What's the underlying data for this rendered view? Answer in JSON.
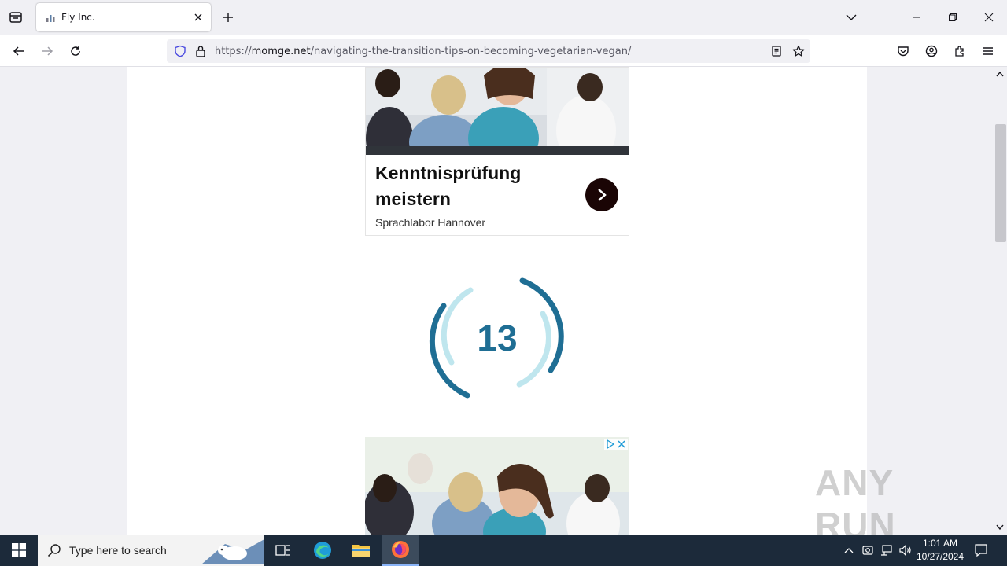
{
  "browser": {
    "tab": {
      "title": "Fly Inc."
    },
    "url": {
      "scheme": "https://",
      "host": "momge.net",
      "path": "/navigating-the-transition-tips-on-becoming-vegetarian-vegan/"
    }
  },
  "ad_top": {
    "title": "Kenntnisprüfung meistern",
    "source": "Sprachlabor Hannover"
  },
  "countdown": {
    "value": "13"
  },
  "watermark": {
    "text": "ANY RUN"
  },
  "taskbar": {
    "search_placeholder": "Type here to search",
    "clock_time": "1:01 AM",
    "clock_date": "10/27/2024"
  },
  "colors": {
    "countdown_dark": "#1f6e94",
    "countdown_light": "#bfe6ee",
    "taskbar_bg": "#1c2a3a"
  }
}
